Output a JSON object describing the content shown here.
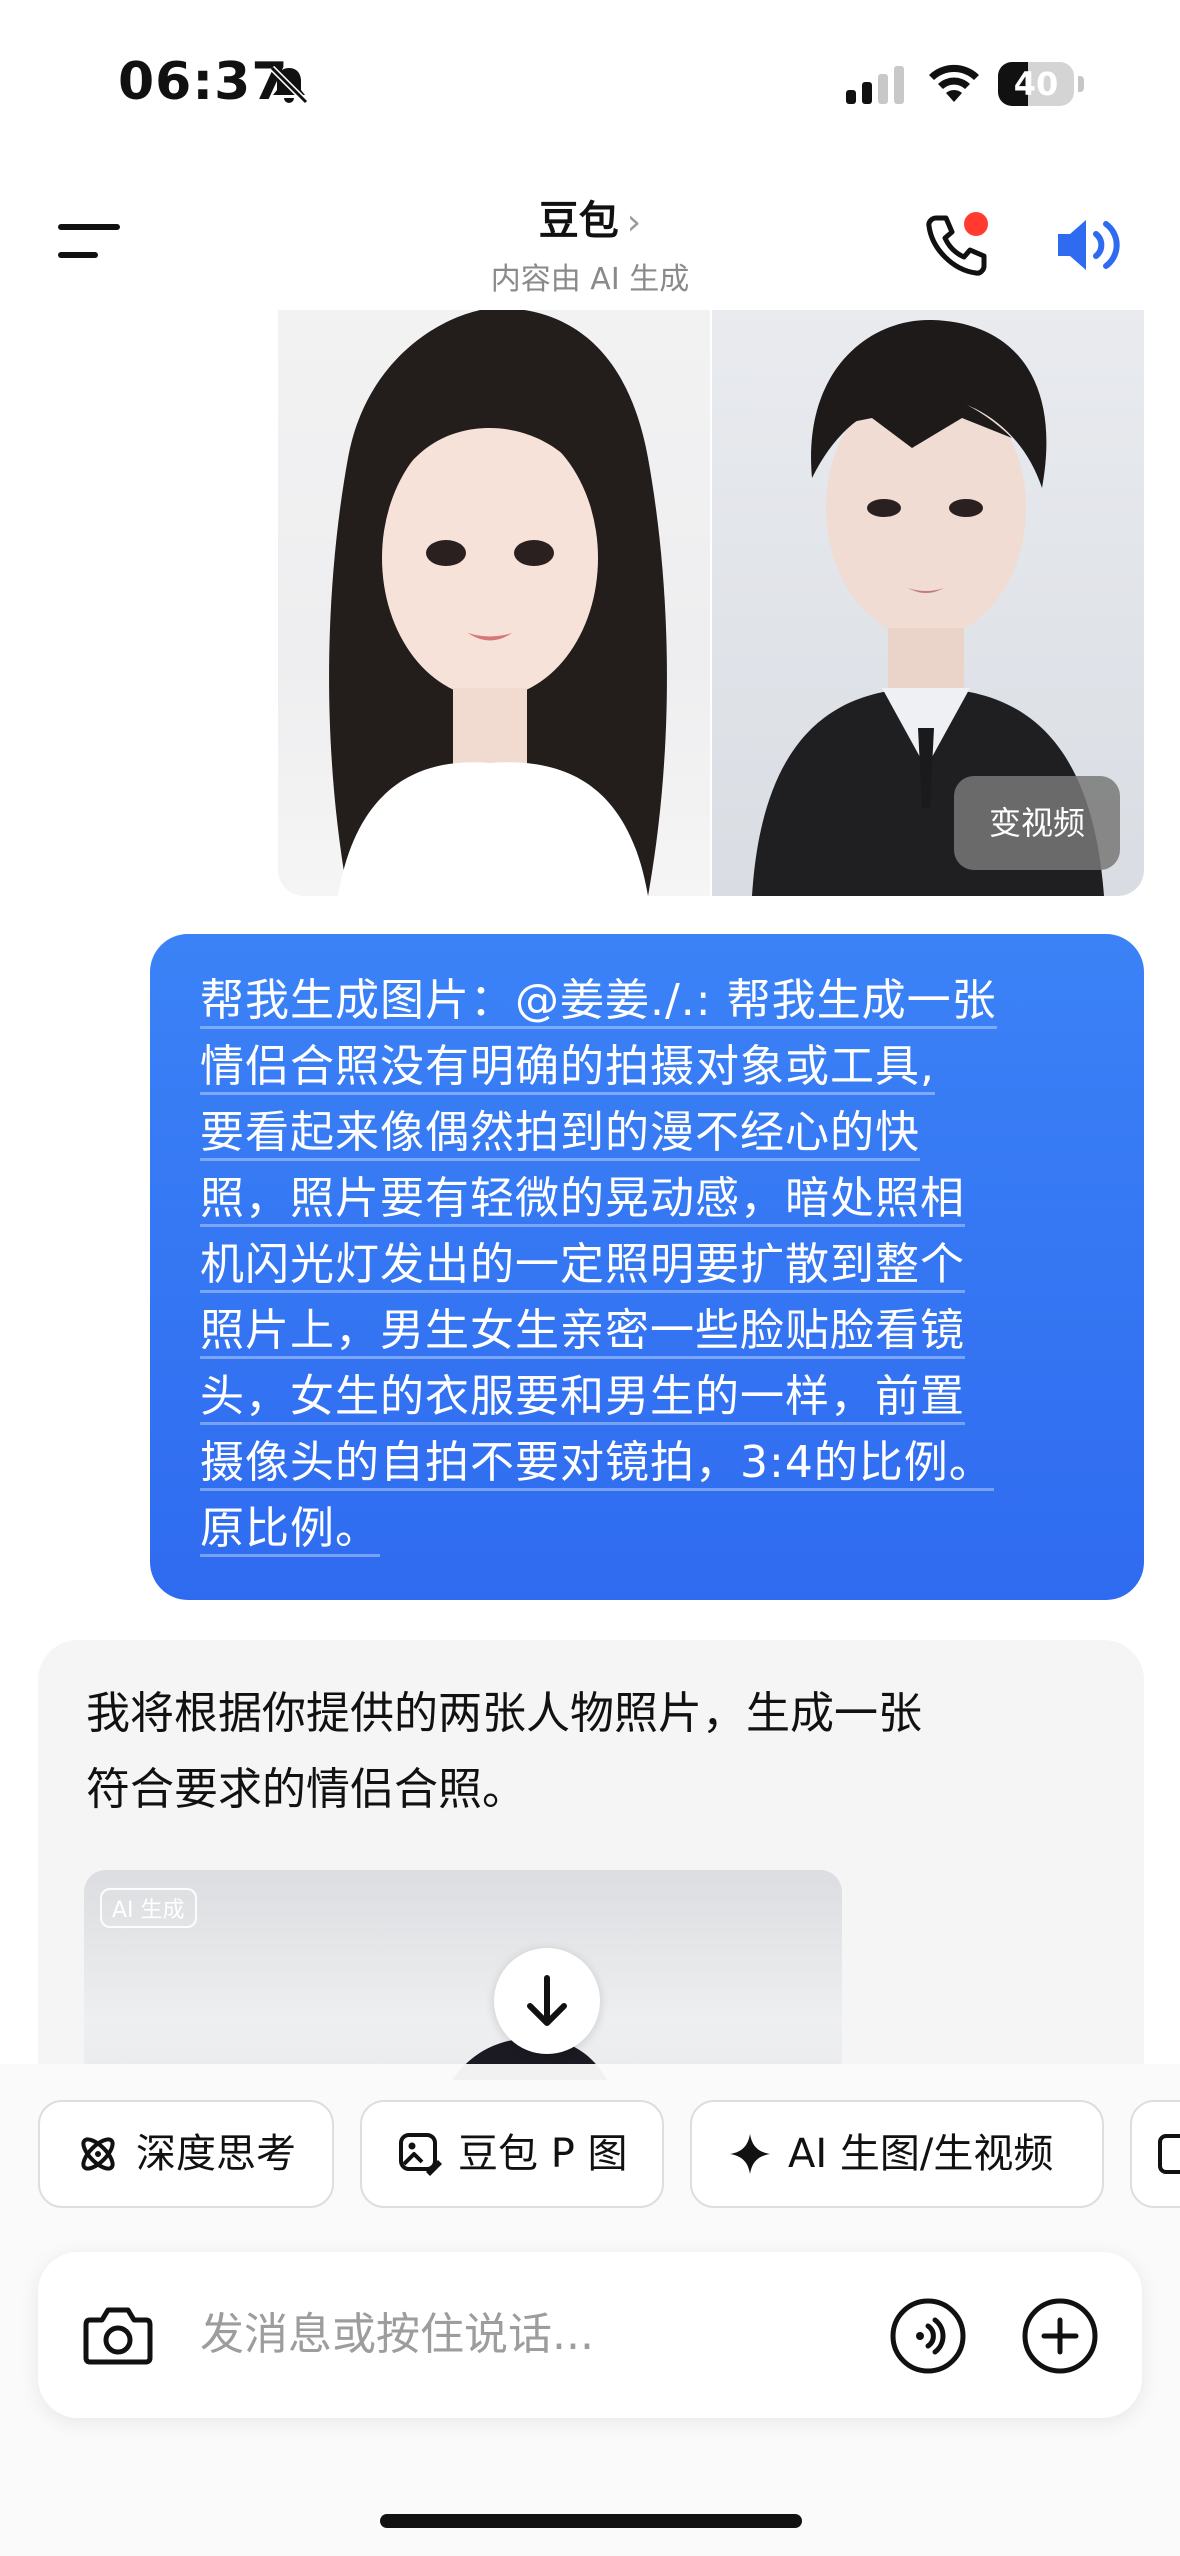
{
  "status": {
    "time": "06:37",
    "battery": "40"
  },
  "header": {
    "title": "豆包",
    "subtitle": "内容由 AI 生成"
  },
  "photo_pair": {
    "action_label": "变视频"
  },
  "user_message": {
    "lines": [
      "帮我生成图片：@姜姜./.: 帮我生成一张",
      "情侣合照没有明确的拍摄对象或工具,",
      "要看起来像偶然拍到的漫不经心的快",
      "照，照片要有轻微的晃动感，暗处照相",
      "机闪光灯发出的一定照明要扩散到整个",
      "照片上，男生女生亲密一些脸贴脸看镜",
      "头，女生的衣服要和男生的一样，前置",
      "摄像头的自拍不要对镜拍，3:4的比例。",
      "原比例。"
    ]
  },
  "ai_message": {
    "lines": [
      "我将根据你提供的两张人物照片，生成一张",
      "符合要求的情侣合照。"
    ],
    "image_badge": "AI 生成"
  },
  "chips": [
    {
      "label": "深度思考",
      "icon": "atom-icon"
    },
    {
      "label": "豆包 P 图",
      "icon": "image-edit-icon"
    },
    {
      "label": "AI 生图/生视频",
      "icon": "sparkle-icon"
    }
  ],
  "input": {
    "placeholder": "发消息或按住说话..."
  },
  "colors": {
    "accent": "#2f6bf0",
    "notify": "#ff3b30"
  }
}
